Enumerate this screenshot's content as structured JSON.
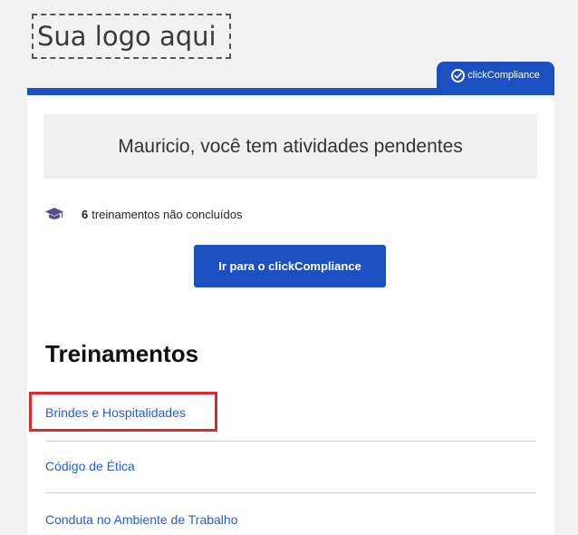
{
  "header": {
    "logo_placeholder": "Sua logo aqui",
    "brand_label": "clickCompliance"
  },
  "notice": {
    "message": "Mauricio, você tem atividades pendentes"
  },
  "pending": {
    "icon": "graduation-cap-icon",
    "count": "6",
    "label": "treinamentos não concluídos"
  },
  "cta": {
    "label": "Ir para o clickCompliance"
  },
  "trainings": {
    "title": "Treinamentos",
    "items": [
      {
        "label": "Brindes e Hospitalidades",
        "highlighted": true
      },
      {
        "label": "Código de Ética",
        "highlighted": false
      },
      {
        "label": "Conduta no Ambiente de Trabalho",
        "highlighted": false
      }
    ]
  },
  "colors": {
    "brand_blue": "#1c4fbf",
    "link_blue": "#1f5fd6",
    "highlight_red": "#e0282d",
    "background": "#f2f2f2"
  }
}
